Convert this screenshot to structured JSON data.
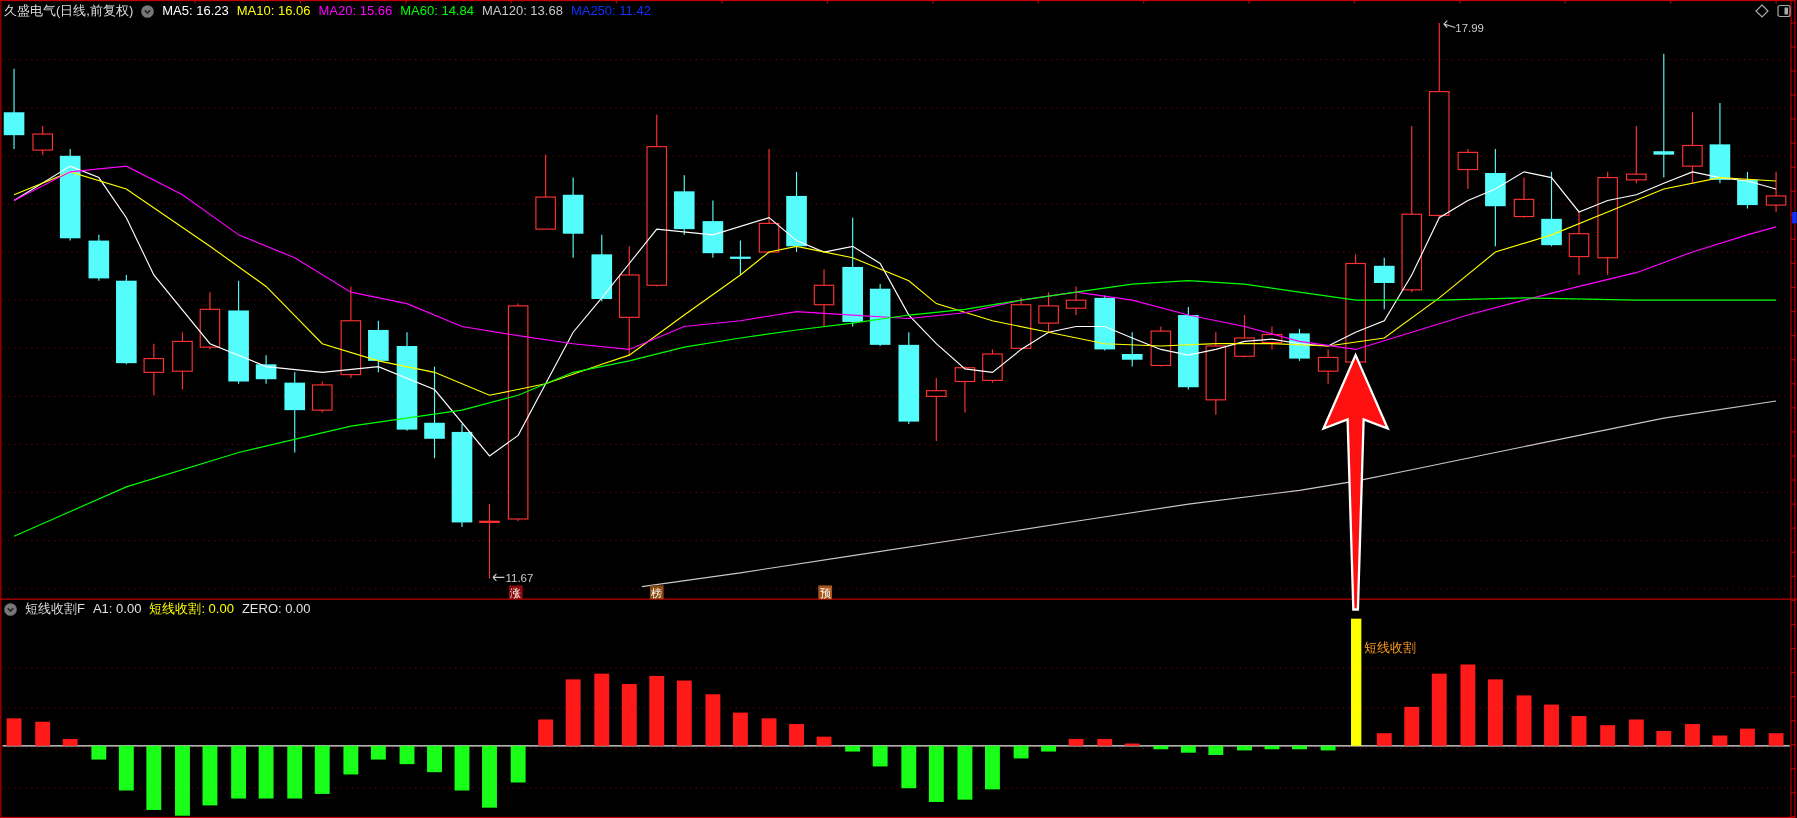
{
  "main_panel": {
    "title": "久盛电气(日线,前复权)",
    "moving_averages": [
      {
        "label": "MA5: 16.23",
        "color": "#ffffff"
      },
      {
        "label": "MA10: 16.06",
        "color": "#ffff00"
      },
      {
        "label": "MA20: 15.66",
        "color": "#ff00ff"
      },
      {
        "label": "MA60: 14.84",
        "color": "#00ff00"
      },
      {
        "label": "MA120: 13.68",
        "color": "#c8c8c8"
      },
      {
        "label": "MA250: 11.42",
        "color": "#1030ff"
      }
    ],
    "high_label": "17.99",
    "low_label": "11.67",
    "event_markers": [
      {
        "text": "涨",
        "color": "#8b0a0a"
      },
      {
        "text": "榜",
        "color": "#8a4a10"
      },
      {
        "text": "预",
        "color": "#a9561a"
      }
    ]
  },
  "indicator_panel": {
    "title": "短线收割F",
    "values": [
      {
        "label": "A1: 0.00",
        "color": "#e0e0e0"
      },
      {
        "label": "短线收割: 0.00",
        "color": "#ffff00"
      },
      {
        "label": "ZERO: 0.00",
        "color": "#e0e0e0"
      }
    ],
    "signal_label": "短线收割"
  }
}
